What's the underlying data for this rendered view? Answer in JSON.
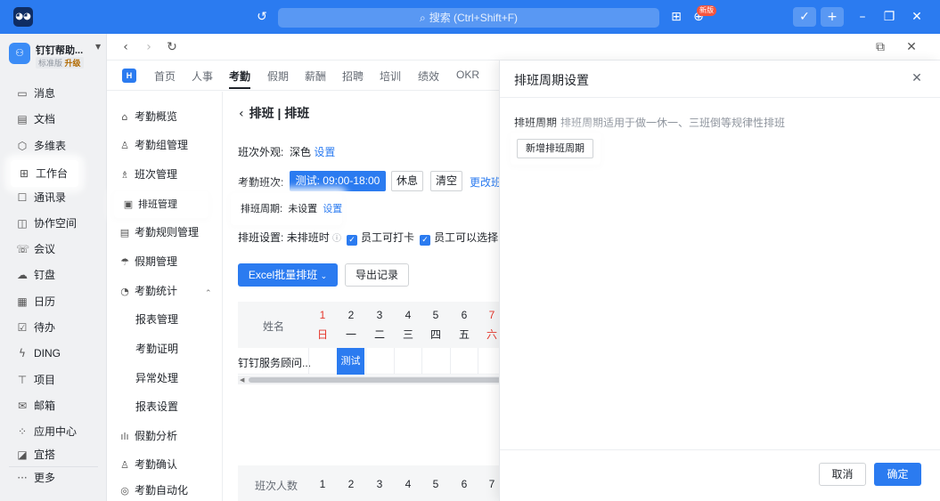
{
  "titlebar": {
    "search_placeholder": "搜索 (Ctrl+Shift+F)",
    "new_badge": "新版",
    "accent": "#2b7bf0"
  },
  "org": {
    "name": "钉钉帮助...",
    "tier": "标准版",
    "upgrade": "升级"
  },
  "leftnav": {
    "items": [
      {
        "label": "消息",
        "icon": "message-icon"
      },
      {
        "label": "文档",
        "icon": "document-icon"
      },
      {
        "label": "多维表",
        "icon": "table-icon"
      },
      {
        "label": "工作台",
        "icon": "workbench-icon"
      },
      {
        "label": "通讯录",
        "icon": "contacts-icon"
      },
      {
        "label": "协作空间",
        "icon": "workspace-icon"
      },
      {
        "label": "会议",
        "icon": "meeting-icon"
      },
      {
        "label": "钉盘",
        "icon": "drive-icon"
      },
      {
        "label": "日历",
        "icon": "calendar-icon"
      },
      {
        "label": "待办",
        "icon": "todo-icon"
      },
      {
        "label": "DING",
        "icon": "ding-icon"
      },
      {
        "label": "项目",
        "icon": "project-icon"
      },
      {
        "label": "邮箱",
        "icon": "mail-icon"
      },
      {
        "label": "应用中心",
        "icon": "apps-icon"
      },
      {
        "label": "宜搭",
        "icon": "yida-icon"
      }
    ],
    "more": "更多"
  },
  "apptabs": {
    "badge": "H",
    "tabs": [
      "首页",
      "人事",
      "考勤",
      "假期",
      "薪酬",
      "招聘",
      "培训",
      "绩效",
      "OKR"
    ]
  },
  "subnav": {
    "items": [
      "考勤概览",
      "考勤组管理",
      "班次管理",
      "排班管理",
      "考勤规则管理",
      "假期管理",
      "考勤统计",
      "报表管理",
      "考勤证明",
      "异常处理",
      "报表设置",
      "假勤分析",
      "考勤确认",
      "考勤自动化"
    ]
  },
  "main": {
    "title": "排班 | 排班",
    "shift_display_label": "班次外观:",
    "shift_display_value": "深色",
    "shift_display_link": "设置",
    "shifts_label": "考勤班次:",
    "shift_active": "测试: 09:00-18:00",
    "shift_rest": "休息",
    "shift_clear": "清空",
    "shift_change": "更改班",
    "cycle_label": "排班周期:",
    "cycle_value": "未设置",
    "cycle_link": "设置",
    "settings_label": "排班设置:",
    "settings_unscheduled": "未排班时",
    "settings_option1": "员工可打卡",
    "settings_option2": "员工可以选择",
    "excel_button": "Excel批量排班",
    "export_button": "导出记录",
    "grid": {
      "name_header": "姓名",
      "days": [
        {
          "num": "1",
          "weekday": "日",
          "weekend": true
        },
        {
          "num": "2",
          "weekday": "一",
          "weekend": false
        },
        {
          "num": "3",
          "weekday": "二",
          "weekend": false
        },
        {
          "num": "4",
          "weekday": "三",
          "weekend": false
        },
        {
          "num": "5",
          "weekday": "四",
          "weekend": false
        },
        {
          "num": "6",
          "weekday": "五",
          "weekend": false
        },
        {
          "num": "7",
          "weekday": "六",
          "weekend": true
        }
      ],
      "employee": "钉钉服务顾问...",
      "shift_cell": "测试",
      "footer_label": "班次人数",
      "footer_days": [
        "1",
        "2",
        "3",
        "4",
        "5",
        "6",
        "7"
      ]
    }
  },
  "drawer": {
    "title": "排班周期设置",
    "desc_label": "排班周期",
    "desc_hint": "排班周期适用于做一休一、三班倒等规律性排班",
    "add_button": "新增排班周期",
    "cancel": "取消",
    "ok": "确定"
  }
}
